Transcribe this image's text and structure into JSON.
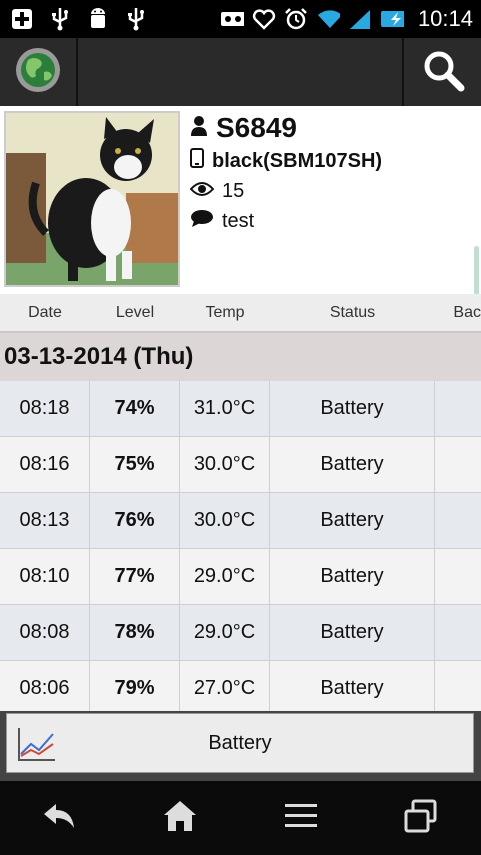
{
  "status_bar": {
    "time": "10:14",
    "left_icons": [
      "add-icon",
      "usb-icon",
      "android-icon",
      "usb-icon"
    ],
    "right_icons": [
      "voicemail-icon",
      "heart-icon",
      "alarm-icon",
      "wifi-icon",
      "signal-icon",
      "battery-charging-icon"
    ]
  },
  "app_bar": {
    "left_icon": "globe-icon",
    "right_icon": "search-icon"
  },
  "profile": {
    "name": "S6849",
    "device": "black(SBM107SH)",
    "views": "15",
    "comment": "test"
  },
  "table": {
    "columns": [
      "Date",
      "Level",
      "Temp",
      "Status",
      "Bac"
    ],
    "date_group": "03-13-2014 (Thu)",
    "rows": [
      {
        "time": "08:18",
        "level": "74%",
        "temp": "31.0°C",
        "status": "Battery"
      },
      {
        "time": "08:16",
        "level": "75%",
        "temp": "30.0°C",
        "status": "Battery"
      },
      {
        "time": "08:13",
        "level": "76%",
        "temp": "30.0°C",
        "status": "Battery"
      },
      {
        "time": "08:10",
        "level": "77%",
        "temp": "29.0°C",
        "status": "Battery"
      },
      {
        "time": "08:08",
        "level": "78%",
        "temp": "29.0°C",
        "status": "Battery"
      },
      {
        "time": "08:06",
        "level": "79%",
        "temp": "27.0°C",
        "status": "Battery"
      }
    ]
  },
  "bottom_button": {
    "label": "Battery",
    "icon": "chart-icon"
  },
  "nav": [
    "back-icon",
    "home-icon",
    "menu-icon",
    "recent-apps-icon"
  ],
  "colors": {
    "status_bar_bg": "#000000",
    "app_bar_bg": "#2a2a2a",
    "row_alt_bg": "#e6eaee",
    "date_group_bg": "#dcd6d6",
    "wifi": "#29a9e0",
    "signal": "#29a9e0",
    "battery": "#29a9e0"
  }
}
